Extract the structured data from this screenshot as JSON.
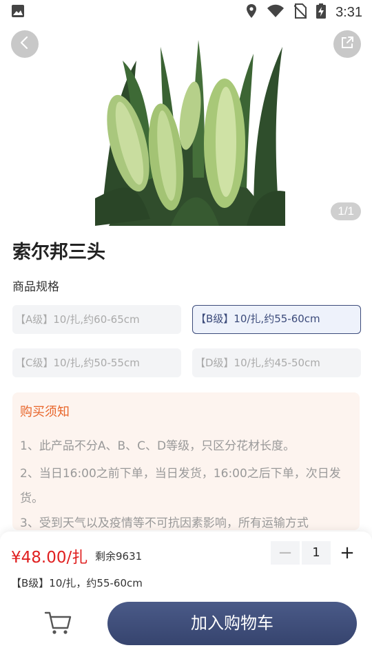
{
  "status_bar": {
    "time": "3:31"
  },
  "gallery": {
    "counter": "1/1"
  },
  "product": {
    "title": "索尔邦三头",
    "spec_label": "商品规格",
    "specs": [
      {
        "label": "【A级】10/扎,约60-65cm",
        "selected": false
      },
      {
        "label": "【B级】10/扎,约55-60cm",
        "selected": true
      },
      {
        "label": "【C级】10/扎,约50-55cm",
        "selected": false
      },
      {
        "label": "【D级】10/扎,约45-50cm",
        "selected": false
      }
    ]
  },
  "notice": {
    "title": "购买须知",
    "lines": [
      "1、此产品不分A、B、C、D等级，只区分花材长度。",
      "2、当日16:00之前下单，当日发货，16:00之后下单，次日发货。",
      "3、受到天气以及疫情等不可抗因素影响，所有运输方式"
    ]
  },
  "purchase_bar": {
    "price": "¥48.00/扎",
    "stock": "剩余9631",
    "quantity": "1",
    "minus": "−",
    "plus": "+",
    "selected_spec": "【B级】10/扎，约55-60cm",
    "add_to_cart": "加入购物车"
  },
  "colors": {
    "accent": "#3b4a7a",
    "price": "#e02020",
    "notice_title": "#e8652a",
    "notice_bg": "#fdf4ef"
  },
  "icons": [
    "image-icon",
    "location-icon",
    "wifi-icon",
    "no-sim-icon",
    "battery-charging-icon",
    "back-icon",
    "share-icon",
    "cart-icon"
  ]
}
